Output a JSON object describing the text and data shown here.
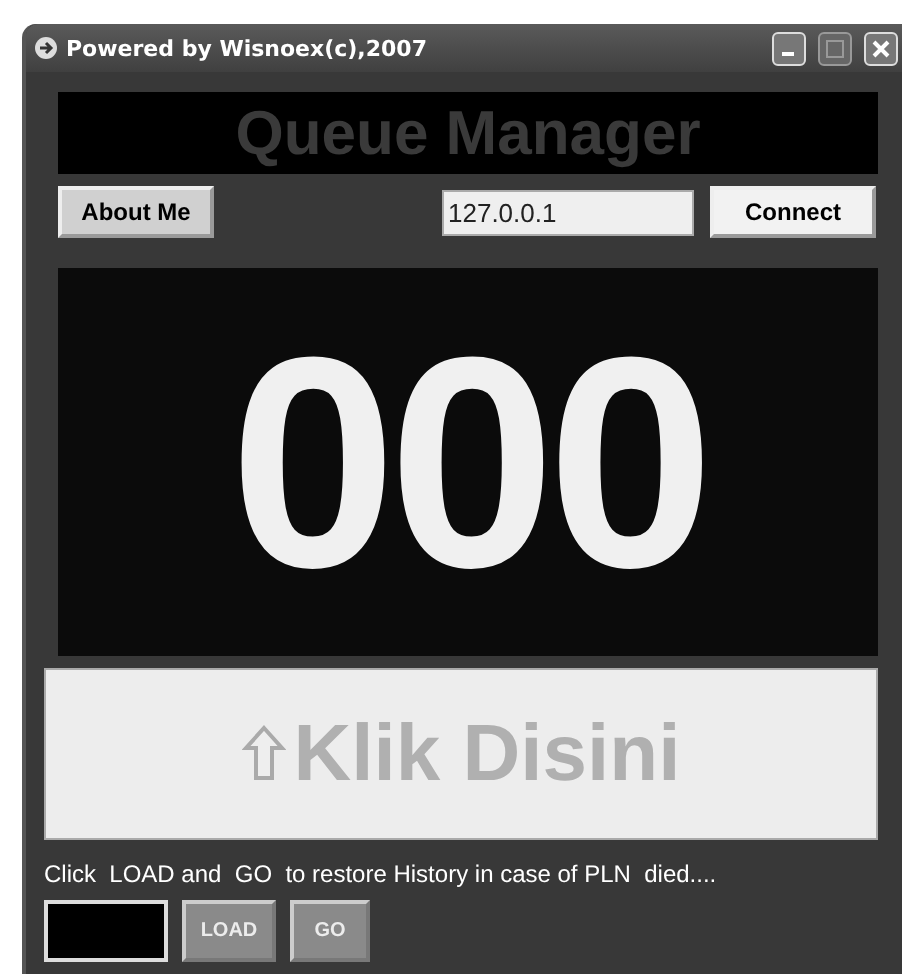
{
  "window": {
    "title": "Powered by Wisnoex(c),2007"
  },
  "banner": {
    "title": "Queue Manager"
  },
  "about_button": {
    "label": "About Me"
  },
  "server_field": {
    "value": "127.0.0.1"
  },
  "connect_button": {
    "label": "Connect"
  },
  "counter": {
    "value": "000"
  },
  "call_button": {
    "label": "Klik Disini"
  },
  "hint": "Click  LOAD and  GO  to restore History in case of PLN  died....",
  "bottom_buttons": [
    {
      "label": "LOAD",
      "disabled": true
    },
    {
      "label": "GO",
      "disabled": true
    }
  ]
}
